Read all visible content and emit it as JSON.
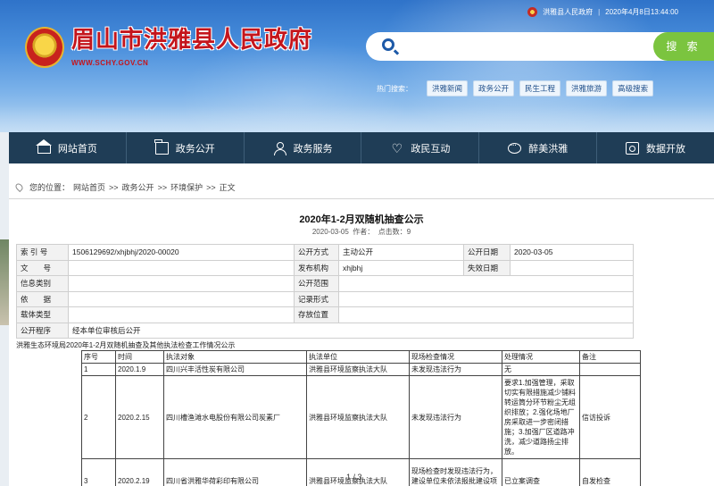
{
  "topbar": {
    "site_name": "洪雅县人民政府",
    "datetime": "2020年4月8日13:44:00"
  },
  "logo": {
    "title": "眉山市洪雅县人民政府",
    "url": "WWW.SCHY.GOV.CN"
  },
  "search": {
    "value": "",
    "button_label": "搜 索"
  },
  "hot_search": {
    "label": "热门搜索：",
    "items": [
      "洪雅新闻",
      "政务公开",
      "民生工程",
      "洪雅旅游",
      "高级搜索"
    ]
  },
  "nav": [
    {
      "label": "网站首页",
      "icon": "home-icon"
    },
    {
      "label": "政务公开",
      "icon": "folder-icon"
    },
    {
      "label": "政务服务",
      "icon": "user-icon"
    },
    {
      "label": "政民互动",
      "icon": "heart-icon"
    },
    {
      "label": "醉美洪雅",
      "icon": "chat-icon"
    },
    {
      "label": "数据开放",
      "icon": "data-icon"
    }
  ],
  "breadcrumb": {
    "prefix": "您的位置：",
    "items": [
      "网站首页",
      ">>",
      "政务公开",
      ">>",
      "环境保护",
      ">>",
      "正文"
    ]
  },
  "article": {
    "title": "2020年1-2月双随机抽查公示",
    "date": "2020-03-05",
    "author_label": "作者：",
    "clicks_label": "点击数：",
    "clicks": "9"
  },
  "info": {
    "index_label": "索 引 号",
    "index_value": "1506129692/xhjbhj/2020-00020",
    "open_method_label": "公开方式",
    "open_method_value": "主动公开",
    "open_date_label": "公开日期",
    "open_date_value": "2020-03-05",
    "doc_no_label": "文　　号",
    "doc_no_value": "",
    "publisher_label": "发布机构",
    "publisher_value": "xhjbhj",
    "expire_label": "失效日期",
    "expire_value": "",
    "category_label": "信息类别",
    "category_value": "",
    "scope_label": "公开范围",
    "scope_value": "",
    "basis_label": "依　　据",
    "basis_value": "",
    "record_form_label": "记录形式",
    "record_form_value": "",
    "carrier_label": "载体类型",
    "carrier_value": "",
    "storage_label": "存放位置",
    "storage_value": "",
    "procedure_label": "公开程序",
    "procedure_value": "经本单位审核后公开"
  },
  "records": {
    "caption": "洪雅生态环境局2020年1-2月双随机抽查及其他执法检查工作情况公示",
    "headers": [
      "序号",
      "时间",
      "执法对象",
      "执法单位",
      "现场检查情况",
      "处理情况",
      "备注"
    ],
    "rows": [
      [
        "1",
        "2020.1.9",
        "四川兴丰活性炭有限公司",
        "洪雅县环境监察执法大队",
        "未发现违法行为",
        "无",
        ""
      ],
      [
        "2",
        "2020.2.15",
        "四川槽渔滩水电股份有限公司炭素厂",
        "洪雅县环境监察执法大队",
        "未发现违法行为",
        "要求1.加强管理，采取切实有限措施减少铺料转运筒分环节粉尘无组织排放；2.强化场地厂房采取进一步密闭措施；3.加强厂区道路冲洗，减少道路扬尘排放。",
        "信访投诉"
      ],
      [
        "3",
        "2020.2.19",
        "四川省洪雅华荷彩印有限公司",
        "洪雅县环境监察执法大队",
        "现场检查时发现违法行为，建设单位未依法报批建设项目环境影响报告书、报告",
        "已立案调查",
        "自发检查"
      ]
    ]
  },
  "pager": "1 / 3"
}
